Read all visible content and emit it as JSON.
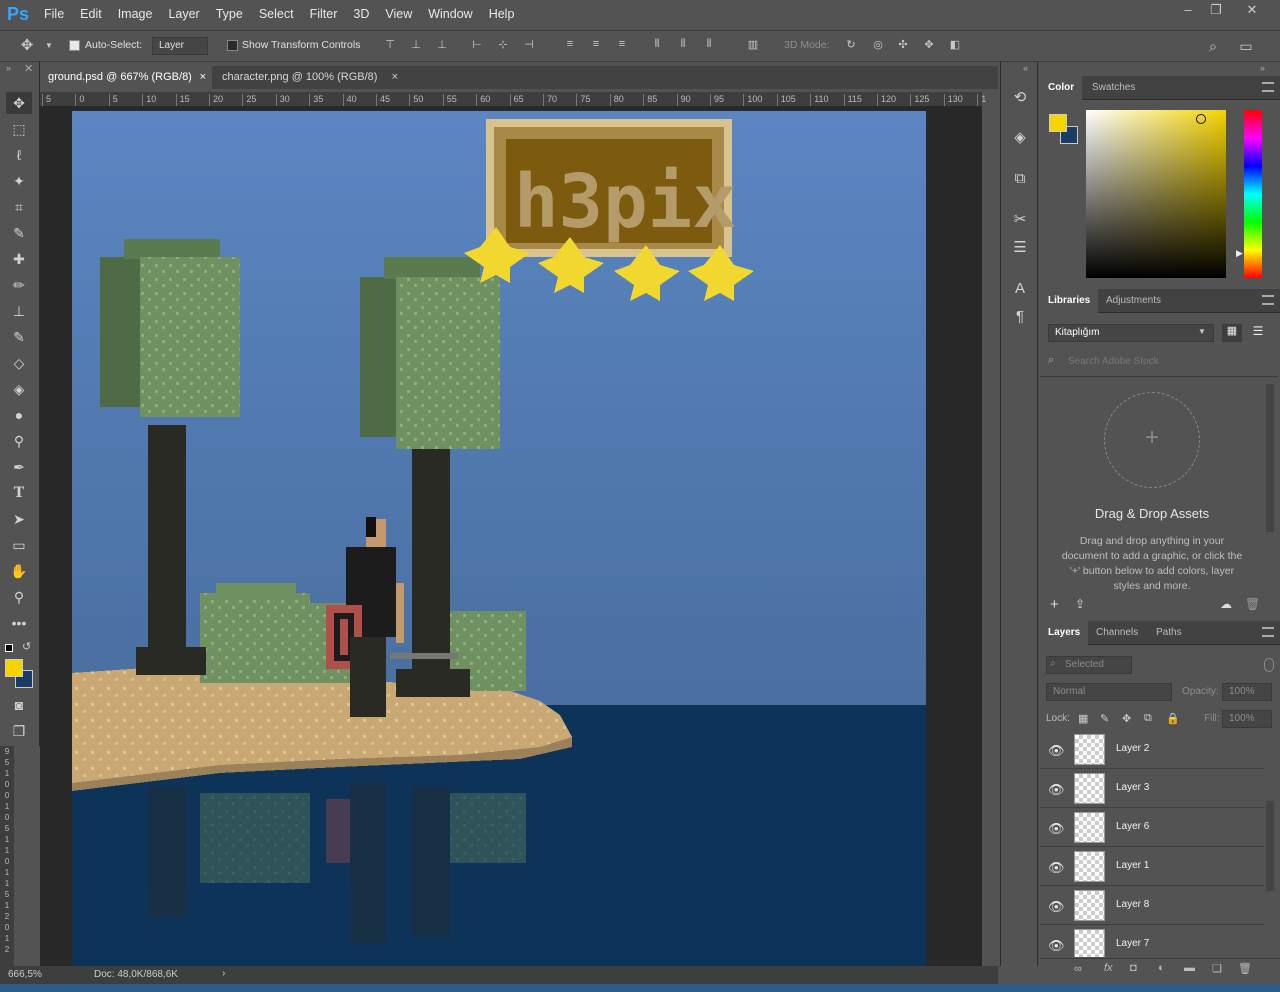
{
  "app": {
    "logo": "Ps"
  },
  "menu": [
    "File",
    "Edit",
    "Image",
    "Layer",
    "Type",
    "Select",
    "Filter",
    "3D",
    "View",
    "Window",
    "Help"
  ],
  "options": {
    "auto_select_label": "Auto-Select:",
    "auto_select_value": "Layer",
    "transform_label": "Show Transform Controls",
    "mode3d_label": "3D Mode:"
  },
  "tabs": [
    {
      "label": "ground.psd @ 667% (RGB/8)",
      "close": "×"
    },
    {
      "label": "character.png @ 100% (RGB/8)",
      "close": "×"
    }
  ],
  "ruler": {
    "ticks": [
      "5",
      "0",
      "5",
      "10",
      "15",
      "20",
      "25",
      "30",
      "35",
      "40",
      "45",
      "50",
      "55",
      "60",
      "65",
      "70",
      "75",
      "80",
      "85",
      "90",
      "95",
      "100",
      "105",
      "110",
      "115",
      "120",
      "125",
      "130",
      "1"
    ],
    "left_ticks": [
      "9",
      "5",
      "1",
      "0",
      "0",
      "1",
      "0",
      "5",
      "1",
      "1",
      "0",
      "1",
      "1",
      "5",
      "1",
      "2",
      "0",
      "1",
      "2"
    ]
  },
  "status": {
    "zoom": "666,5%",
    "doc": "Doc: 48,0K/868,6K",
    "arrow": "›"
  },
  "color_panel": {
    "tabs": [
      "Color",
      "Swatches"
    ],
    "fg": "#f5d400",
    "bg": "#1a3d66"
  },
  "libraries": {
    "tabs": [
      "Libraries",
      "Adjustments"
    ],
    "library_name": "Kitaplığım",
    "search_placeholder": "Search Adobe Stock",
    "drop_title": "Drag & Drop Assets",
    "drop_text": "Drag and drop anything in your document to add a graphic, or click the '+' button below to add colors, layer styles and more.",
    "plus": "+"
  },
  "layers_panel": {
    "tabs": [
      "Layers",
      "Channels",
      "Paths"
    ],
    "filter": "Selected",
    "blend": "Normal",
    "opacity_label": "Opacity:",
    "opacity": "100%",
    "lock_label": "Lock:",
    "fill_label": "Fill:",
    "fill": "100%",
    "layers": [
      "Layer 2",
      "Layer 3",
      "Layer 6",
      "Layer 1",
      "Layer 8",
      "Layer 7"
    ]
  },
  "logo_text": "h3pix"
}
